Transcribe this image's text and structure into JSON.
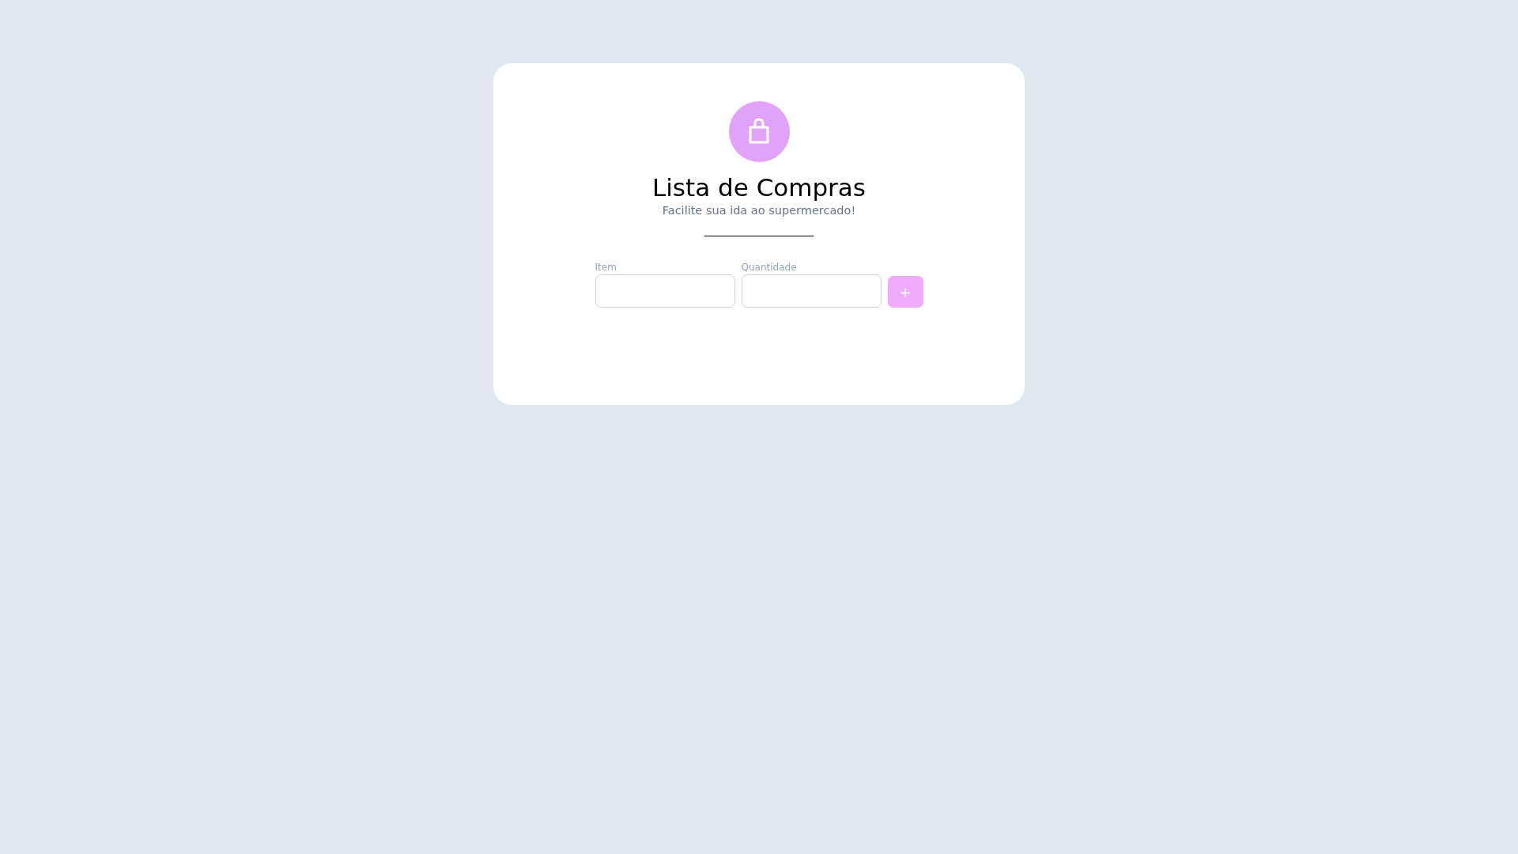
{
  "header": {
    "title": "Lista de Compras",
    "subtitle": "Facilite sua ida ao supermercado!"
  },
  "form": {
    "fields": [
      {
        "label": "Item"
      },
      {
        "label": "Quantidade"
      }
    ],
    "add_button": "+"
  }
}
